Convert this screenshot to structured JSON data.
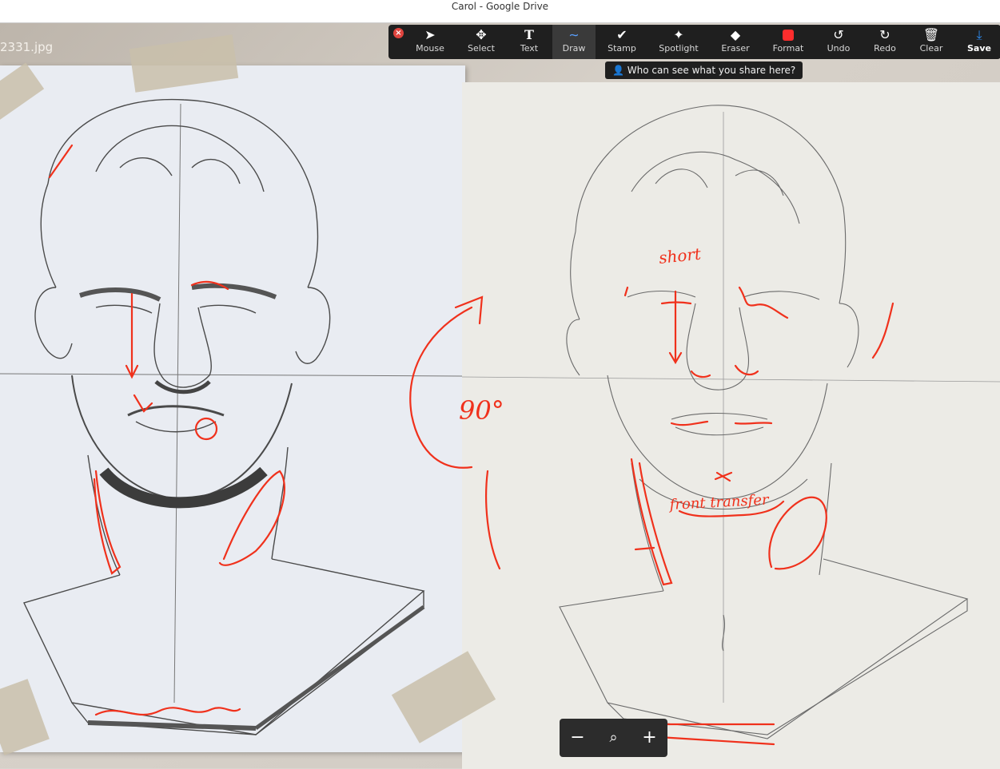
{
  "window": {
    "title": "Carol - Google Drive"
  },
  "file": {
    "name": "2331.jpg"
  },
  "toolbar": {
    "tools": [
      {
        "label": "Mouse",
        "icon": "arrow-cursor-icon"
      },
      {
        "label": "Select",
        "icon": "move-arrows-icon"
      },
      {
        "label": "Text",
        "icon": "text-t-icon"
      },
      {
        "label": "Draw",
        "icon": "squiggle-icon",
        "active": true
      },
      {
        "label": "Stamp",
        "icon": "checkmark-icon"
      },
      {
        "label": "Spotlight",
        "icon": "magic-wand-icon"
      },
      {
        "label": "Eraser",
        "icon": "eraser-icon"
      },
      {
        "label": "Format",
        "icon": "color-swatch-icon",
        "color": "#ff2d2d"
      },
      {
        "label": "Undo",
        "icon": "undo-icon"
      },
      {
        "label": "Redo",
        "icon": "redo-icon"
      },
      {
        "label": "Clear",
        "icon": "trash-icon"
      },
      {
        "label": "Save",
        "icon": "save-download-icon"
      }
    ]
  },
  "share_tip": {
    "text": "Who can see what you share here?"
  },
  "annotations": {
    "word_short": "short",
    "word_angle": "90°",
    "word_front": "front transfer"
  },
  "colors": {
    "annotation": "#f0311c",
    "pencil": "#5d5d5d"
  }
}
